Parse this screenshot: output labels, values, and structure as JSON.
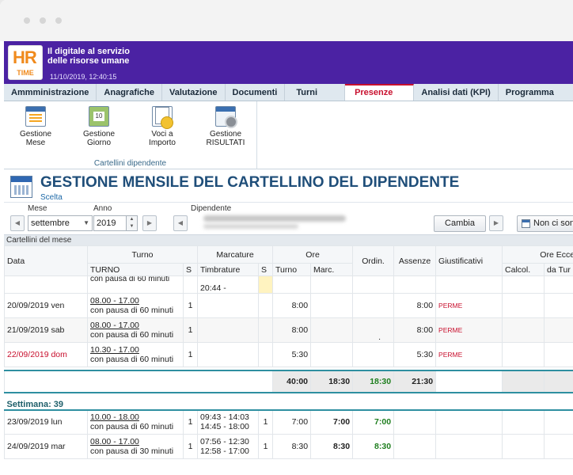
{
  "banner": {
    "logo_top": "HR",
    "logo_bottom": "TIME",
    "tagline_1": "Il digitale al servizio",
    "tagline_2": "delle risorse umane",
    "datetime": "11/10/2019, 12:40:15"
  },
  "menu": [
    "Ammministrazione",
    "Anagrafiche",
    "Valutazione",
    "Documenti",
    "Turni",
    "Presenze",
    "Analisi dati (KPI)",
    "Programma"
  ],
  "menu_active": "Presenze",
  "ribbon": {
    "buttons": [
      {
        "l1": "Gestione",
        "l2": "Mese"
      },
      {
        "l1": "Gestione",
        "l2": "Giorno"
      },
      {
        "l1": "Voci a",
        "l2": "Importo"
      },
      {
        "l1": "Gestione",
        "l2": "RISULTATI"
      }
    ],
    "group_label": "Cartellini dipendente"
  },
  "page": {
    "title": "GESTIONE MENSILE DEL CARTELLINO DEL DIPENDENTE",
    "subtitle": "Scelta"
  },
  "filters": {
    "mese_label": "Mese",
    "mese_value": "settembre",
    "anno_label": "Anno",
    "anno_value": "2019",
    "dipendente_label": "Dipendente",
    "cambia": "Cambia",
    "non_ci_sono": "Non ci sono"
  },
  "section": "Cartellini del mese",
  "table": {
    "h_data": "Data",
    "h_turno": "Turno",
    "h_marcature": "Marcature",
    "h_ore": "Ore",
    "h_ordin": "Ordin.",
    "h_assenze": "Assenze",
    "h_giust": "Giustificativi",
    "h_ore_ecc": "Ore Ecce",
    "s_turno": "TURNO",
    "s_s1": "S",
    "s_timbrature": "Timbrature",
    "s_s2": "S",
    "s_ore_turno": "Turno",
    "s_marc": "Marc.",
    "s_calcol": "Calcol.",
    "s_da_tur": "da Tur",
    "partial": {
      "turno": "con pausa di 60 minuti",
      "timb": "20:44 -"
    },
    "rows": [
      {
        "data": "20/09/2019 ven",
        "turno": "08.00 - 17.00",
        "pausa": "con pausa di 60 minuti",
        "s": "1",
        "timb1": "",
        "timb2": "",
        "s2": "",
        "ore_turno": "8:00",
        "marc": "",
        "ordin": "",
        "assenze": "8:00",
        "giust": "PERME"
      },
      {
        "data": "21/09/2019 sab",
        "turno": "08.00 - 17.00",
        "pausa": "con pausa di 60 minuti",
        "s": "1",
        "timb1": "",
        "timb2": "",
        "s2": "",
        "ore_turno": "8:00",
        "marc": "",
        "ordin": ".",
        "assenze": "8:00",
        "giust": "PERME"
      },
      {
        "data": "22/09/2019 dom",
        "turno": "10.30 - 17.00",
        "pausa": "con pausa di 60 minuti",
        "s": "1",
        "timb1": "",
        "timb2": "",
        "s2": "",
        "ore_turno": "5:30",
        "marc": "",
        "ordin": "",
        "assenze": "5:30",
        "giust": "PERME"
      }
    ],
    "totals": {
      "ore_turno": "40:00",
      "marc": "18:30",
      "ordin": "18:30",
      "assenze": "21:30"
    },
    "week_label": "Settimana: 39",
    "rows2": [
      {
        "data": "23/09/2019 lun",
        "turno": "10.00 - 18.00",
        "pausa": "con pausa di 60 minuti",
        "s": "1",
        "timb1": "09:43 - 14:03",
        "timb2": "14:45 - 18:00",
        "s2": "1",
        "ore_turno": "7:00",
        "marc": "7:00",
        "ordin": "7:00",
        "assenze": "",
        "giust": ""
      },
      {
        "data": "24/09/2019 mar",
        "turno": "08.00 - 17.00",
        "pausa": "con pausa di 30 minuti",
        "s": "1",
        "timb1": "07:56 - 12:30",
        "timb2": "12:58 - 17:00",
        "s2": "1",
        "ore_turno": "8:30",
        "marc": "8:30",
        "ordin": "8:30",
        "assenze": "",
        "giust": ""
      }
    ]
  },
  "colors": {
    "banner": "#4b22a3",
    "active_menu": "#c8102e",
    "title": "#1f4e79",
    "accent": "#2e8fa0"
  }
}
